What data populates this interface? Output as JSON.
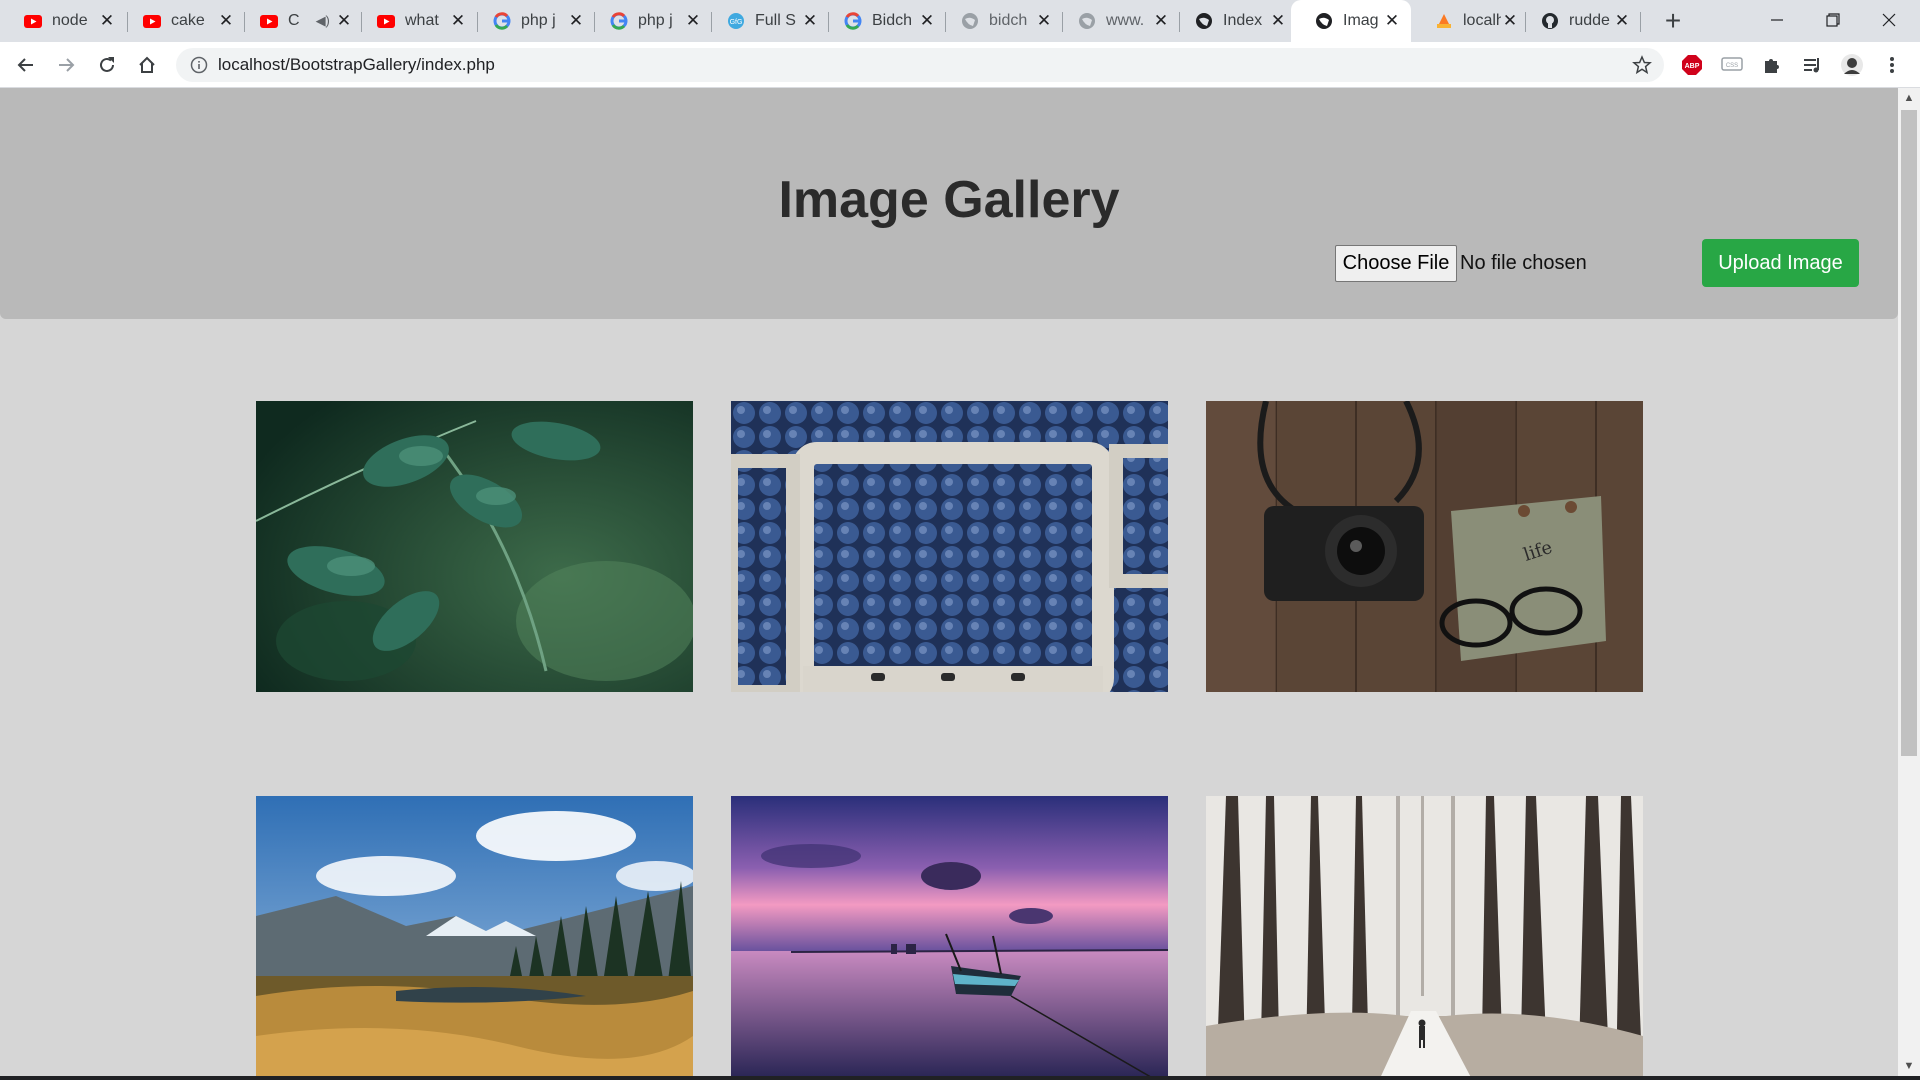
{
  "browser": {
    "tabs": [
      {
        "title": "node",
        "icon": "youtube-icon"
      },
      {
        "title": "cake",
        "icon": "youtube-icon"
      },
      {
        "title": "C",
        "icon": "youtube-icon"
      },
      {
        "title": "what",
        "icon": "youtube-icon"
      },
      {
        "title": "php j",
        "icon": "google-icon"
      },
      {
        "title": "php j",
        "icon": "google-icon"
      },
      {
        "title": "Full S",
        "icon": "site-icon"
      },
      {
        "title": "Bidch",
        "icon": "google-icon"
      },
      {
        "title": "bidch",
        "icon": "globe-icon"
      },
      {
        "title": "www.",
        "icon": "globe-icon"
      },
      {
        "title": "Index",
        "icon": "globe-icon"
      },
      {
        "title": "Imag",
        "icon": "globe-icon"
      },
      {
        "title": "localh",
        "icon": "xampp-icon"
      },
      {
        "title": "rudde",
        "icon": "github-icon"
      }
    ],
    "url": "localhost/BootstrapGallery/index.php"
  },
  "page": {
    "title": "Image Gallery",
    "file_button": "Choose File",
    "file_status": "No file chosen",
    "upload_button": "Upload Image"
  },
  "gallery": {
    "images": [
      {
        "subject": "green parsley leaves"
      },
      {
        "subject": "blueberries in cartons"
      },
      {
        "subject": "camera and glasses on wooden table"
      },
      {
        "subject": "mountain meadow with pine forest"
      },
      {
        "subject": "boat on lake at sunset"
      },
      {
        "subject": "person walking in snowy forest"
      }
    ]
  },
  "colors": {
    "accent": "#28a745",
    "jumbotron": "#b9b9b9",
    "page_background": "#d6d6d6"
  }
}
